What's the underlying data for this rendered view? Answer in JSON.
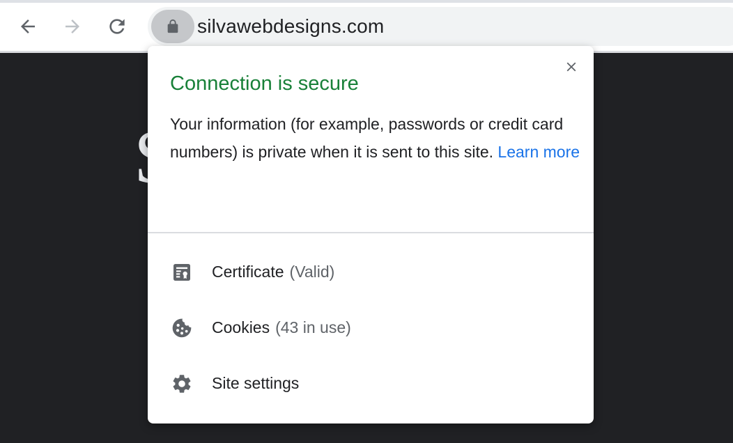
{
  "browser": {
    "url": "silvawebdesigns.com",
    "back_icon": "arrow-back-icon",
    "forward_icon": "arrow-forward-icon",
    "reload_icon": "reload-icon",
    "lock_icon": "lock-icon"
  },
  "page": {
    "glyph": "S"
  },
  "popup": {
    "title": "Connection is secure",
    "description": "Your information (for example, passwords or credit card numbers) is private when it is sent to this site.",
    "learn_more": "Learn more",
    "items": [
      {
        "label": "Certificate",
        "detail": "(Valid)",
        "icon": "certificate-icon"
      },
      {
        "label": "Cookies",
        "detail": "(43 in use)",
        "icon": "cookie-icon"
      },
      {
        "label": "Site settings",
        "detail": "",
        "icon": "gear-icon"
      }
    ]
  },
  "colors": {
    "title_green": "#188038",
    "link_blue": "#1a73e8",
    "page_bg": "#202124"
  }
}
